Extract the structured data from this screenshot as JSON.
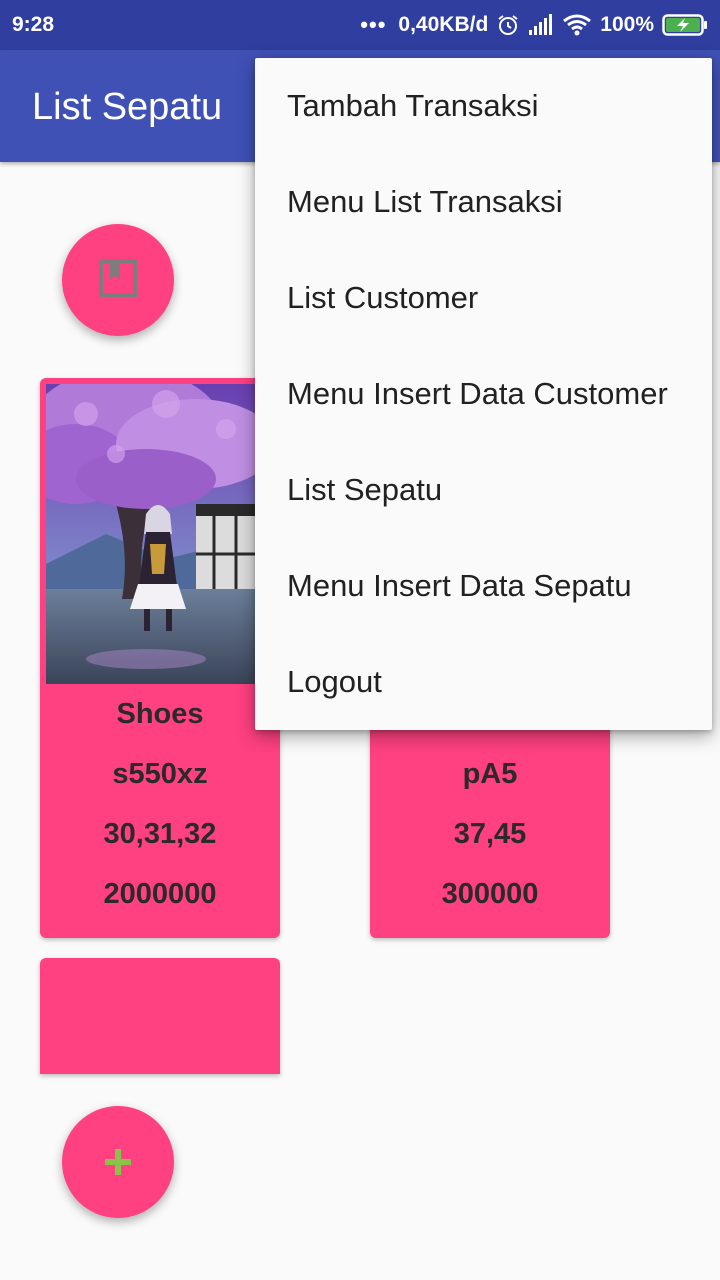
{
  "status_bar": {
    "time": "9:28",
    "dots": "•••",
    "speed": "0,40KB/d",
    "battery": "100%"
  },
  "app_bar": {
    "title": "List Sepatu"
  },
  "menu": {
    "items": [
      "Tambah Transaksi",
      "Menu List Transaksi",
      "List Customer",
      "Menu Insert Data Customer",
      "List Sepatu",
      "Menu Insert Data Sepatu",
      "Logout"
    ]
  },
  "cards": [
    {
      "name": "Shoes",
      "code": "s550xz",
      "sizes": "30,31,32",
      "price": "2000000"
    },
    {
      "name": "",
      "code": "pA5",
      "sizes": "37,45",
      "price": "300000"
    }
  ],
  "icons": {
    "top_fab": "bookmark-icon",
    "bottom_fab": "plus-icon"
  },
  "colors": {
    "primary": "#3f51b5",
    "primary_dark": "#303f9f",
    "accent": "#ff4081",
    "plus": "#8bc34a"
  }
}
